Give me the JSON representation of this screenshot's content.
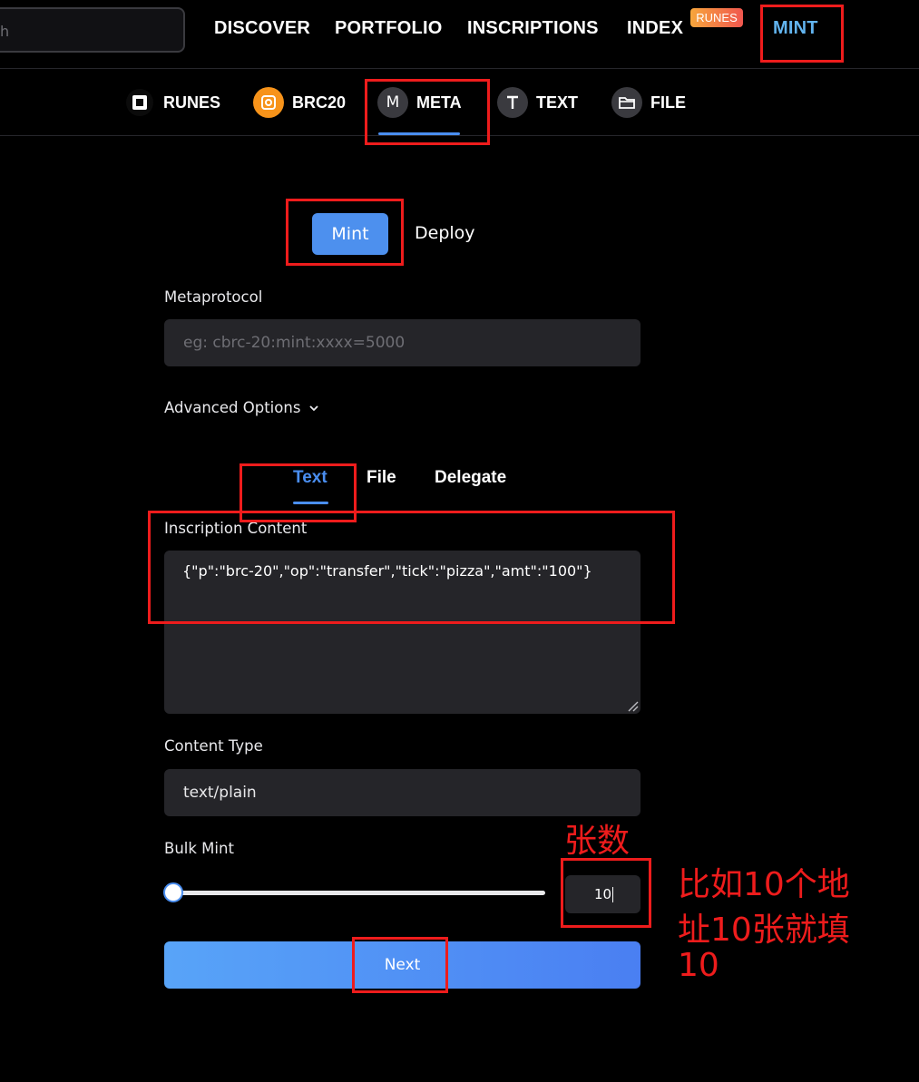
{
  "nav": {
    "search_placeholder": "h",
    "links": [
      "DISCOVER",
      "PORTFOLIO",
      "INSCRIPTIONS",
      "INDEX",
      "MINT"
    ],
    "index_badge": "RUNES",
    "accent_color": "#62b4ef"
  },
  "subtabs": [
    {
      "label": "RUNES",
      "icon": "runes-icon"
    },
    {
      "label": "BRC20",
      "icon": "brc20-icon"
    },
    {
      "label": "META",
      "icon": "meta-icon",
      "icon_letter": "M",
      "active": true
    },
    {
      "label": "TEXT",
      "icon": "text-icon",
      "icon_letter": "T"
    },
    {
      "label": "FILE",
      "icon": "folder-icon"
    }
  ],
  "mode_toggle": {
    "mint": "Mint",
    "deploy": "Deploy",
    "selected": "Mint"
  },
  "form": {
    "metaprotocol_label": "Metaprotocol",
    "metaprotocol_placeholder": "eg: cbrc-20:mint:xxxx=5000",
    "advanced_options": "Advanced Options",
    "content_tabs": [
      "Text",
      "File",
      "Delegate"
    ],
    "content_tab_selected": "Text",
    "inscription_content_label": "Inscription Content",
    "inscription_content_value": "{\"p\":\"brc-20\",\"op\":\"transfer\",\"tick\":\"pizza\",\"amt\":\"100\"}",
    "content_type_label": "Content Type",
    "content_type_value": "text/plain",
    "bulk_mint_label": "Bulk Mint",
    "bulk_mint_value": "10",
    "bulk_mint_slider_fraction": 0.0,
    "next_button": "Next"
  },
  "annotations": {
    "quantity_note": "张数",
    "example_line1": "比如10个地",
    "example_line2": "址10张就填",
    "example_line3": "10",
    "color": "#ee1c1c"
  }
}
